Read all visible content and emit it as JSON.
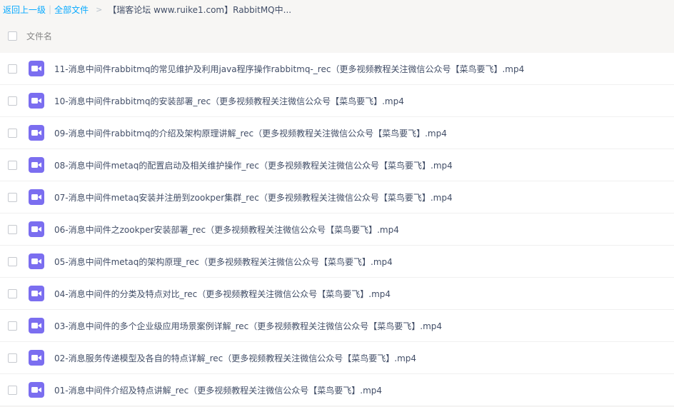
{
  "breadcrumb": {
    "back": "返回上一级",
    "all_files": "全部文件",
    "current": "【瑞客论坛 www.ruike1.com】RabbitMQ中..."
  },
  "list_header": {
    "column": "文件名"
  },
  "colors": {
    "video_icon": "#7b6ef0",
    "link": "#09aaff"
  },
  "files": [
    {
      "name": "11-消息中间件rabbitmq的常见维护及利用java程序操作rabbitmq-_rec（更多视频教程关注微信公众号【菜鸟要飞】.mp4",
      "icon": "video-file-icon"
    },
    {
      "name": "10-消息中间件rabbitmq的安装部署_rec（更多视频教程关注微信公众号【菜鸟要飞】.mp4",
      "icon": "video-file-icon"
    },
    {
      "name": "09-消息中间件rabbitmq的介绍及架构原理讲解_rec（更多视频教程关注微信公众号【菜鸟要飞】.mp4",
      "icon": "video-file-icon"
    },
    {
      "name": "08-消息中间件metaq的配置启动及相关维护操作_rec（更多视频教程关注微信公众号【菜鸟要飞】.mp4",
      "icon": "video-file-icon"
    },
    {
      "name": "07-消息中间件metaq安装并注册到zookper集群_rec（更多视频教程关注微信公众号【菜鸟要飞】.mp4",
      "icon": "video-file-icon"
    },
    {
      "name": "06-消息中间件之zookper安装部署_rec（更多视频教程关注微信公众号【菜鸟要飞】.mp4",
      "icon": "video-file-icon"
    },
    {
      "name": "05-消息中间件metaq的架构原理_rec（更多视频教程关注微信公众号【菜鸟要飞】.mp4",
      "icon": "video-file-icon"
    },
    {
      "name": "04-消息中间件的分类及特点对比_rec（更多视频教程关注微信公众号【菜鸟要飞】.mp4",
      "icon": "video-file-icon"
    },
    {
      "name": "03-消息中间件的多个企业级应用场景案例详解_rec（更多视频教程关注微信公众号【菜鸟要飞】.mp4",
      "icon": "video-file-icon"
    },
    {
      "name": "02-消息服务传递模型及各自的特点详解_rec（更多视频教程关注微信公众号【菜鸟要飞】.mp4",
      "icon": "video-file-icon"
    },
    {
      "name": "01-消息中间件介绍及特点讲解_rec（更多视频教程关注微信公众号【菜鸟要飞】.mp4",
      "icon": "video-file-icon"
    }
  ]
}
